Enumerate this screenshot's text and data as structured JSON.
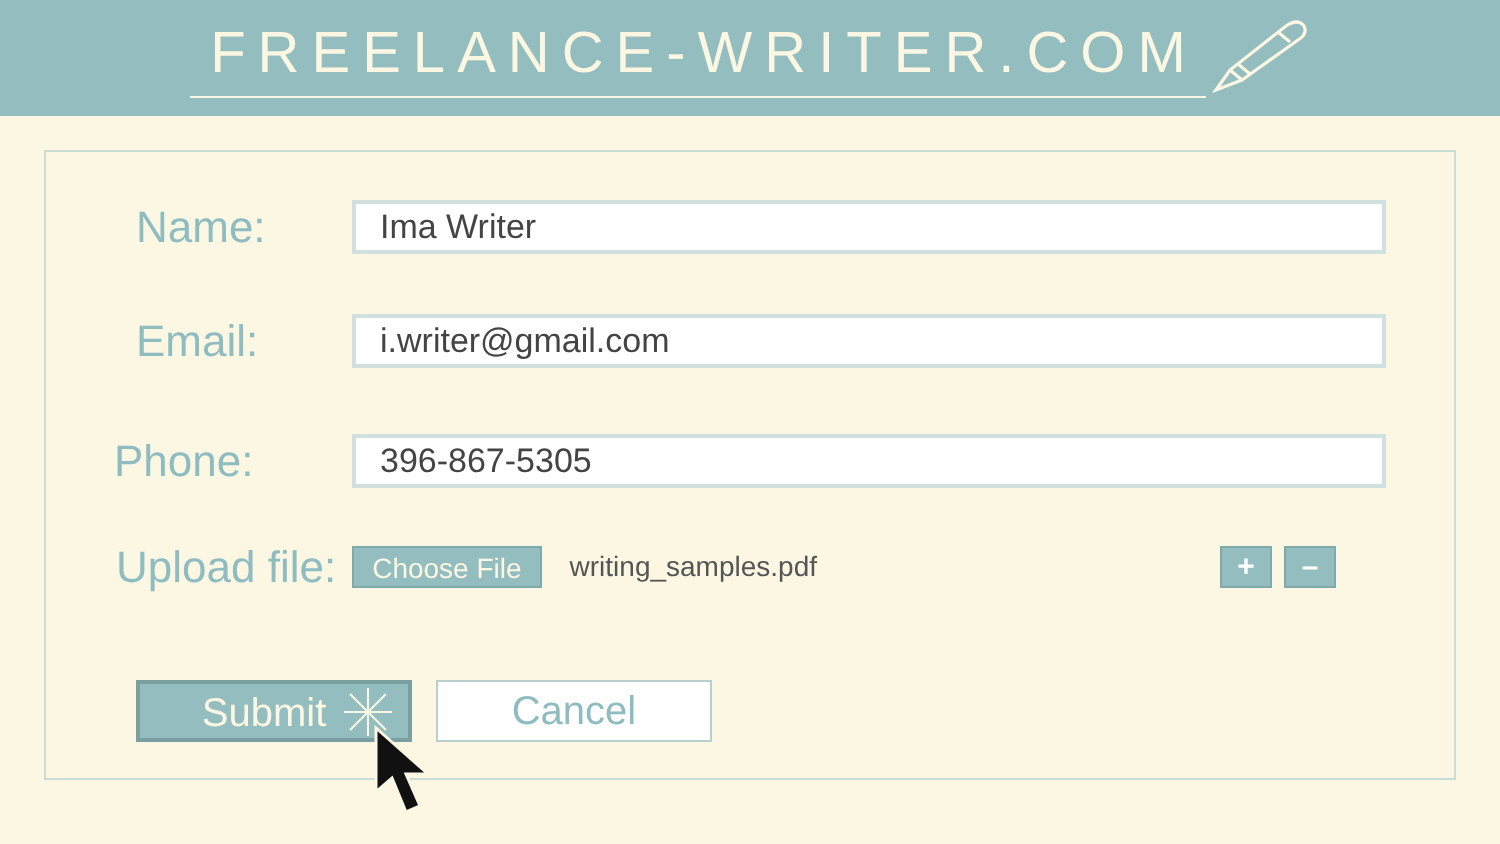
{
  "header": {
    "title": "FREELANCE-WRITER.COM"
  },
  "fields": [
    {
      "label": "Name:",
      "value": "Ima Writer"
    },
    {
      "label": "Email:",
      "value": "i.writer@gmail.com"
    },
    {
      "label": "Phone:",
      "value": "396-867-5305"
    }
  ],
  "upload": {
    "label": "Upload file:",
    "button": "Choose File",
    "file_name": "writing_samples.pdf",
    "add": "+",
    "remove": "–"
  },
  "buttons": [
    {
      "label": "Submit",
      "kind": "primary"
    },
    {
      "label": "Cancel",
      "kind": "secondary"
    }
  ]
}
